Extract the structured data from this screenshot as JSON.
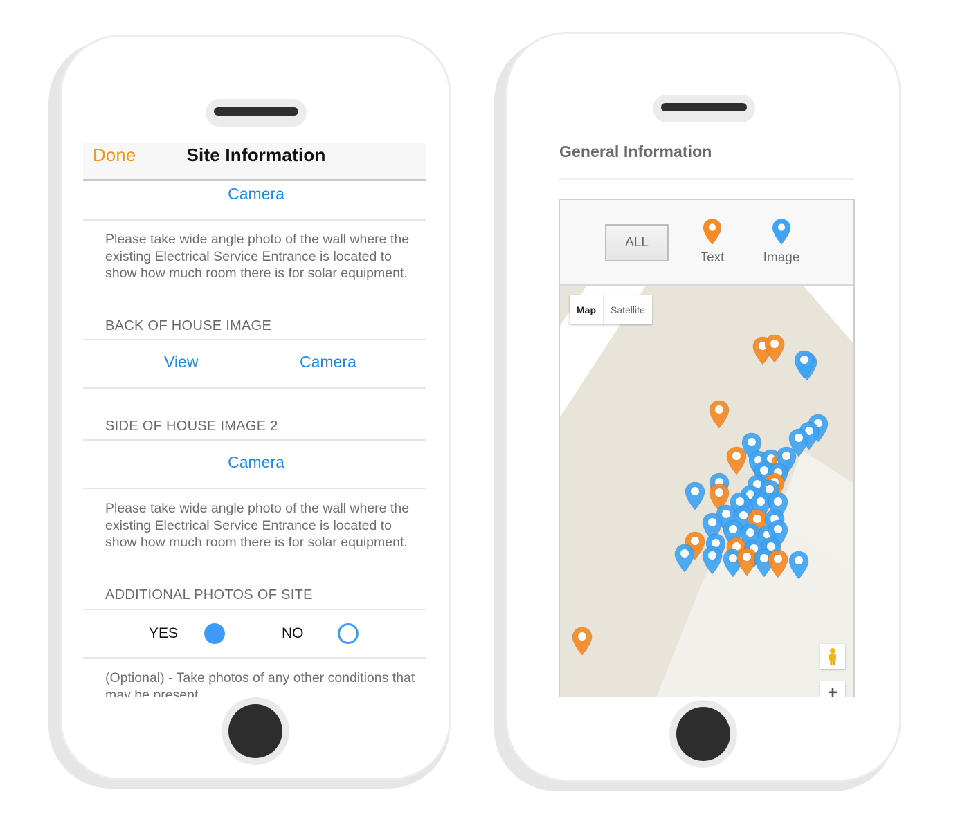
{
  "left_phone": {
    "navbar": {
      "done_label": "Done",
      "title": "Site Information"
    },
    "rows": {
      "camera_1": "Camera",
      "description_1": "Please take wide angle photo of the wall where the existing Electrical Service Entrance is located  to show how much room there is for solar equipment.",
      "section_back": "BACK OF HOUSE IMAGE",
      "view_label": "View",
      "camera_2": "Camera",
      "section_side": "SIDE OF HOUSE IMAGE 2",
      "camera_3": "Camera",
      "description_2": "Please take wide angle photo of the wall where the existing Electrical Service Entrance is located  to show how much room there is for solar equipment.",
      "section_additional": "ADDITIONAL PHOTOS OF SITE",
      "yes_label": "YES",
      "no_label": "NO",
      "selected": "YES",
      "optional_text": "(Optional) - Take photos of any other conditions that may be present"
    },
    "colors": {
      "accent_orange": "#f5951d",
      "link_blue": "#1a8cf0",
      "radio_blue": "#3d9bf7"
    }
  },
  "right_phone": {
    "title": "General Information",
    "filter": {
      "all_label": "ALL",
      "text_label": "Text",
      "image_label": "Image",
      "text_marker_color": "#f68b26",
      "image_marker_color": "#3fa4f5"
    },
    "map": {
      "map_type_options": [
        "Map",
        "Satellite"
      ],
      "selected_map_type": "Map",
      "zoom_in_label": "+",
      "controls": [
        "pegman-icon",
        "zoom-in-button"
      ]
    }
  }
}
